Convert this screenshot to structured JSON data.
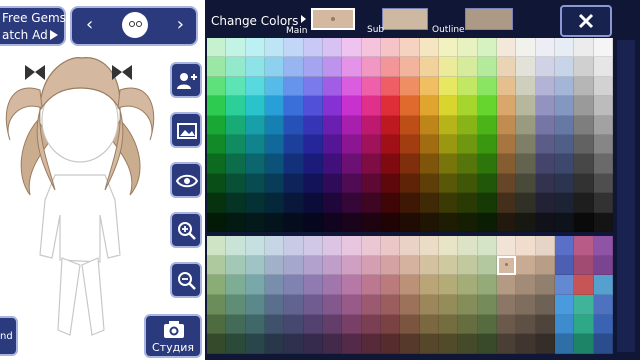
{
  "left_panel": {
    "gems_line1": "Free Gems",
    "gems_line2": "atch Ad",
    "studio_label": "Студия",
    "corner_label": "nd"
  },
  "color_panel": {
    "title": "Change Colors",
    "labels": {
      "main": "Main",
      "sub": "Sub",
      "outline": "Outline"
    },
    "swatches": {
      "main": "#d4b89f",
      "sub": "#cdb9a1",
      "outline": "#ad9a86"
    },
    "close_glyph": "X"
  },
  "icons": [
    "chevron-left-icon",
    "face-icon",
    "chevron-right-icon",
    "add-person-icon",
    "image-icon",
    "eye-icon",
    "zoom-in-icon",
    "zoom-out-icon",
    "camera-icon",
    "close-icon",
    "play-icon"
  ],
  "palette": {
    "top_rows": [
      [
        "#c6f2d0",
        "#c2f3e4",
        "#bdf0f2",
        "#bde5f5",
        "#c2d6f7",
        "#c9c9f7",
        "#d8c2f4",
        "#efc3f0",
        "#f6c3dd",
        "#f6c4c6",
        "#f6d3c1",
        "#f6e5c1",
        "#f2f2c1",
        "#e8f2c1",
        "#d6f2c1",
        "#f3e8d9",
        "#f2f2ec",
        "#ededf5",
        "#e7edf5",
        "#ececec",
        "#f5f5f5"
      ],
      [
        "#9ae7a6",
        "#93e9cb",
        "#8ee3e8",
        "#8ed1ee",
        "#97b5f1",
        "#a4a4f1",
        "#bd93ed",
        "#e494e8",
        "#f197c3",
        "#f29699",
        "#f2b49c",
        "#f2d29b",
        "#ebeb9b",
        "#d6eb9b",
        "#b4ea9b",
        "#ebd4b4",
        "#e2e2d8",
        "#d2d2e7",
        "#c8d5e8",
        "#d0d0d0",
        "#e6e6e6"
      ],
      [
        "#5ee07a",
        "#5ce4b4",
        "#58d9e0",
        "#56bbe9",
        "#6694ec",
        "#7a7aec",
        "#a15de6",
        "#da5de0",
        "#ef60ab",
        "#ef5e64",
        "#ef8e63",
        "#efbf62",
        "#e8e762",
        "#c2e762",
        "#8ae662",
        "#e6bf8f",
        "#cfcfbd",
        "#b3b3d8",
        "#a4b6d8",
        "#b6b6b6",
        "#d2d2d2"
      ],
      [
        "#2dcc50",
        "#2bcf97",
        "#2ac3cc",
        "#289fd6",
        "#3a6ed9",
        "#5050d9",
        "#8531d4",
        "#c931cf",
        "#e0308c",
        "#e02e38",
        "#e0692e",
        "#e0a52e",
        "#d8d62e",
        "#a6d62e",
        "#66d52e",
        "#d9a76b",
        "#b7b79e",
        "#9393c0",
        "#8398c0",
        "#9a9a9a",
        "#bcbcbc"
      ],
      [
        "#1aa834",
        "#19ab76",
        "#18a0aa",
        "#1780b3",
        "#2651b6",
        "#3535b6",
        "#6a1fb1",
        "#a81fad",
        "#bd1a6f",
        "#be1820",
        "#be4e18",
        "#be8618",
        "#b6b418",
        "#88b418",
        "#4bb418",
        "#c08c50",
        "#9a9a80",
        "#7676a4",
        "#6679a4",
        "#7e7e7e",
        "#a2a2a2"
      ],
      [
        "#128a28",
        "#118c60",
        "#10838c",
        "#10699a",
        "#1b3f9a",
        "#26269a",
        "#541695",
        "#8c1692",
        "#a0125a",
        "#a11016",
        "#a13d10",
        "#a16d10",
        "#9a9810",
        "#6f9810",
        "#3a9810",
        "#a67540",
        "#7f7f68",
        "#5c5c88",
        "#4f5f88",
        "#626262",
        "#868686"
      ],
      [
        "#0c6b1e",
        "#0c6d4a",
        "#0b666d",
        "#0b5278",
        "#13307a",
        "#1b1b7a",
        "#41107a",
        "#6d1073",
        "#7e0d46",
        "#7f0b10",
        "#7f2f0b",
        "#7f550b",
        "#78760b",
        "#56760b",
        "#2c760b",
        "#865d30",
        "#63634f",
        "#45456c",
        "#3c496c",
        "#474747",
        "#6a6a6a"
      ],
      [
        "#094e16",
        "#095036",
        "#084b50",
        "#083c58",
        "#0e235a",
        "#13135a",
        "#300b5a",
        "#500b55",
        "#5e0933",
        "#5f080b",
        "#5f2308",
        "#5f3f08",
        "#595708",
        "#405708",
        "#205708",
        "#664528",
        "#4a4a3a",
        "#33334f",
        "#2c354f",
        "#323232",
        "#4e4e4e"
      ],
      [
        "#06330e",
        "#063424",
        "#053134",
        "#05273a",
        "#09173b",
        "#0c0c3b",
        "#20073b",
        "#340738",
        "#3e0622",
        "#3f0507",
        "#3f1705",
        "#3f2a05",
        "#3b3a05",
        "#2a3a05",
        "#153a05",
        "#44301a",
        "#303026",
        "#222234",
        "#1c2334",
        "#1e1e1e",
        "#323232"
      ],
      [
        "#031a07",
        "#031a12",
        "#03191a",
        "#03141d",
        "#050c1e",
        "#06061e",
        "#10041e",
        "#1a041c",
        "#1f0311",
        "#200304",
        "#200c03",
        "#201503",
        "#1e1d03",
        "#151d03",
        "#0b1d03",
        "#22180d",
        "#181813",
        "#11111a",
        "#0e121a",
        "#0a0a0a",
        "#141414"
      ]
    ],
    "bottom_rows": [
      [
        "#cfe4c5",
        "#c9e3d7",
        "#c6e0e2",
        "#c6d6e4",
        "#c9cbe6",
        "#d1c7e6",
        "#dcc4e4",
        "#e8c6e0",
        "#ebc6d3",
        "#ebc7c8",
        "#ebd2c6",
        "#ebdcc6",
        "#e7e5c6",
        "#dde4c6",
        "#d5e3c6",
        "#f1e3d6",
        "#f0ddcd",
        "#e6d4c6",
        "#5a6fc7",
        "#b85b86",
        "#8f54a5"
      ],
      [
        "#adc99d",
        "#a4c8b6",
        "#a0c3c6",
        "#a0b1c9",
        "#a5a7cc",
        "#b1a1cc",
        "#bf9ec9",
        "#d0a0c3",
        "#d4a0b1",
        "#d4a2a3",
        "#d4b29f",
        "#d4c19f",
        "#cec99f",
        "#c2c99f",
        "#b4c89f",
        "#d4b89f",
        "#c8ab92",
        "#b99e87",
        "#4c5fb2",
        "#a14b73",
        "#7a4491"
      ],
      [
        "#8aad76",
        "#7ead95",
        "#79a8aa",
        "#798ead",
        "#8083b1",
        "#8f7bb1",
        "#a076ad",
        "#b678a7",
        "#bb7890",
        "#bb7b7d",
        "#bb9177",
        "#bba577",
        "#b3ac77",
        "#a4ac77",
        "#94ab77",
        "#b49a82",
        "#a38c77",
        "#92806e",
        "#6289d1",
        "#c65656",
        "#55a0cf"
      ],
      [
        "#6b8d59",
        "#5f8d75",
        "#5a888b",
        "#5a6f8d",
        "#616491",
        "#705c91",
        "#82588d",
        "#985a88",
        "#9c5a71",
        "#9c5d5f",
        "#9c735a",
        "#9c875a",
        "#948d5a",
        "#858d5a",
        "#758c5a",
        "#8c7766",
        "#7f6d5d",
        "#6e6155",
        "#4a9ade",
        "#3fb49a",
        "#4e72c0"
      ],
      [
        "#4f6b40",
        "#446b57",
        "#40676a",
        "#40526b",
        "#46486f",
        "#53416f",
        "#633e6b",
        "#783f67",
        "#7b3f53",
        "#7b4244",
        "#7b5540",
        "#7b6740",
        "#746d40",
        "#666d40",
        "#566c40",
        "#6b5a4c",
        "#5e5045",
        "#4e443c",
        "#3c8ccf",
        "#2ea887",
        "#3b63b3"
      ],
      [
        "#344a2a",
        "#2c4a3a",
        "#29474a",
        "#29374a",
        "#2e304d",
        "#372b4d",
        "#43294a",
        "#532a47",
        "#562a38",
        "#562c2d",
        "#56392a",
        "#56462a",
        "#514b2a",
        "#454b2a",
        "#394a2a",
        "#4b3e34",
        "#40362f",
        "#342d28",
        "#2d6fa6",
        "#1e8468",
        "#2b4d8d"
      ]
    ]
  }
}
